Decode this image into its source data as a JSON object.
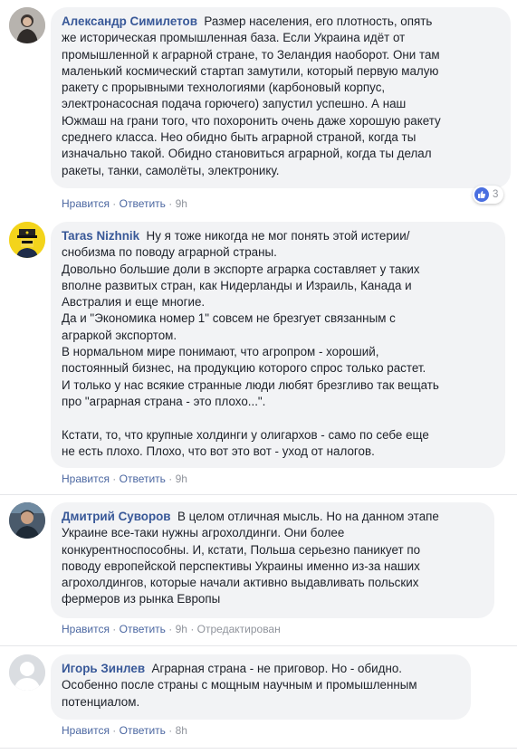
{
  "comments": [
    {
      "author": "Александр Симилетов",
      "text": "Размер населения, его плотность, опять\nже историческая промышленная база. Если Украина идёт от\nпромышленной к аграрной стране, то Зеландия наоборот. Они там\nмаленький космический стартап замутили, который первую малую\nракету с прорывными технологиями (карбоновый корпус,\nэлектронасосная подача горючего) запустил успешно. А наш\nЮжмаш на грани того, что похоронить очень даже хорошую ракету\nсреднего класса. Нео обидно быть аграрной страной, когда ты\nизначально такой. Обидно становиться аграрной, когда ты делал\nракеты, танки, самолёты, электронику.",
      "like_label": "Нравится",
      "reply_label": "Ответить",
      "time": "9h",
      "reaction_count": "3"
    },
    {
      "author": "Taras Nizhnik",
      "text": "Ну я тоже никогда не мог понять этой истерии/\nснобизма по поводу аграрной страны.\nДовольно большие доли в экспорте аграрка составляет у таких\nвполне развитых стран, как Нидерланды и Израиль, Канада и\nАвстралия и еще многие.\nДа и \"Экономика номер 1\" совсем не брезгует связанным с\nаграркой экспортом.\nВ нормальном мире понимают, что агропром - хороший,\nпостоянный бизнес, на продукцию которого спрос только растет.\nИ только у нас всякие странные люди любят брезгливо так вещать\nпро \"аграрная страна - это плохо...\".\n\nКстати, то, что крупные холдинги у олигархов - само по себе еще\nне есть плохо. Плохо, что вот это вот - уход от налогов.",
      "like_label": "Нравится",
      "reply_label": "Ответить",
      "time": "9h"
    },
    {
      "author": "Дмитрий Суворов",
      "text": "В целом отличная мысль. Но на данном этапе\nУкраине все-таки нужны агрохолдинги. Они более\nконкурентноспособны. И, кстати, Польша серьезно паникует по\nповоду европейской перспективы Украины именно из-за наших\nагрохолдингов, которые начали активно выдавливать польских\nфермеров из рынка Европы",
      "like_label": "Нравится",
      "reply_label": "Ответить",
      "time": "9h",
      "edited": "Отредактирован"
    },
    {
      "author": "Игорь Зинлев",
      "text": "Аграрная страна - не приговор. Но - обидно.\nОсобенно после страны с мощным научным и промышленным\nпотенциалом.",
      "like_label": "Нравится",
      "reply_label": "Ответить",
      "time": "8h"
    }
  ],
  "colors": {
    "author": "#385898",
    "link": "#4b67a1",
    "meta": "#90949c",
    "bubble": "#f2f3f5",
    "like_reaction": "#4a6fe0"
  }
}
